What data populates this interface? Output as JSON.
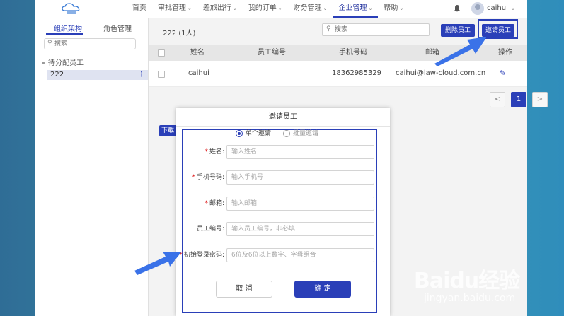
{
  "topbar": {
    "nav": [
      {
        "label": "首页",
        "dropdown": false,
        "active": false
      },
      {
        "label": "审批管理",
        "dropdown": true,
        "active": false
      },
      {
        "label": "差旅出行",
        "dropdown": true,
        "active": false
      },
      {
        "label": "我的订单",
        "dropdown": true,
        "active": false
      },
      {
        "label": "财务管理",
        "dropdown": true,
        "active": false
      },
      {
        "label": "企业管理",
        "dropdown": true,
        "active": true
      },
      {
        "label": "帮助",
        "dropdown": true,
        "active": false
      }
    ],
    "username": "caihui"
  },
  "sidebar": {
    "tabs": [
      "组织架构",
      "角色管理"
    ],
    "search_placeholder": "搜索",
    "group_label": "待分配员工",
    "department": "222"
  },
  "main": {
    "count_label": "222 (1人)",
    "search_placeholder": "搜索",
    "delete_button": "删除员工",
    "invite_button": "邀请员工",
    "columns": [
      "姓名",
      "员工编号",
      "手机号码",
      "邮箱",
      "操作"
    ],
    "rows": [
      {
        "name": "caihui",
        "employee_no": "",
        "phone": "18362985329",
        "email": "caihui@law-cloud.com.cn"
      }
    ],
    "pagination": {
      "prev": "<",
      "current": "1",
      "next": ">"
    },
    "download_button": "下载"
  },
  "modal": {
    "title": "邀请员工",
    "radio_single": "单个邀请",
    "radio_batch": "批量邀请",
    "fields": [
      {
        "label": "姓名:",
        "required": true,
        "placeholder": "输入姓名"
      },
      {
        "label": "手机号码:",
        "required": true,
        "placeholder": "输入手机号"
      },
      {
        "label": "邮箱:",
        "required": true,
        "placeholder": "输入邮箱"
      },
      {
        "label": "员工编号:",
        "required": false,
        "placeholder": "输入员工编号，非必填"
      },
      {
        "label": "初始登录密码:",
        "required": true,
        "placeholder": "6位及6位以上数字、字母组合"
      }
    ],
    "required_mark": "*",
    "cancel_button": "取 消",
    "confirm_button": "确 定"
  },
  "watermark": {
    "brand": "Baidu经验",
    "url": "jingyan.baidu.com"
  },
  "colors": {
    "primary": "#2a3fb8",
    "arrow": "#3a72e8",
    "required": "#e02020"
  }
}
